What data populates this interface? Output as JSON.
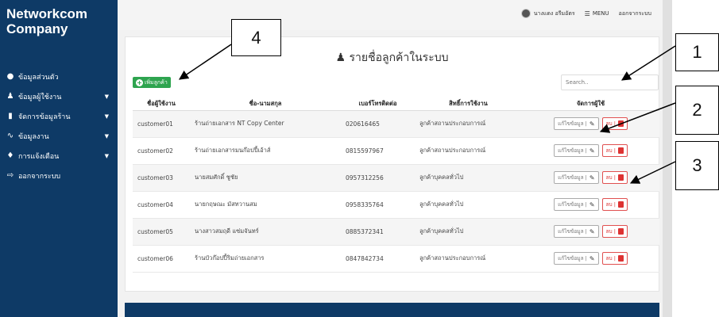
{
  "app": {
    "brand": "Networkcom Company"
  },
  "sidebar": {
    "items": [
      {
        "icon": "user-circle-icon",
        "label": "ข้อมูลส่วนตัว",
        "has_caret": false
      },
      {
        "icon": "users-icon",
        "label": "ข้อมูลผู้ใช้งาน",
        "has_caret": true
      },
      {
        "icon": "clipboard-icon",
        "label": "จัดการข้อมูลร้าน",
        "has_caret": true
      },
      {
        "icon": "chart-line-icon",
        "label": "ข้อมูลงาน",
        "has_caret": true
      },
      {
        "icon": "bell-icon",
        "label": "การแจ้งเตือน",
        "has_caret": true
      },
      {
        "icon": "sign-out-icon",
        "label": "ออกจากระบบ",
        "has_caret": false
      }
    ]
  },
  "topbar": {
    "user_name": "นางแดง อรีมอัตร",
    "menu_label": "MENU",
    "logout_label": "ออกจากระบบ"
  },
  "page": {
    "title": "รายชื่อลูกค้าในระบบ",
    "add_button_label": "เพิ่มลูกค้า",
    "search_placeholder": "Search.."
  },
  "table": {
    "columns": [
      "ชื่อผู้ใช้งาน",
      "ชื่อ-นามสกุล",
      "เบอร์โทรติดต่อ",
      "สิทธิ์การใช้งาน",
      "จัดการผู้ใช้"
    ],
    "edit_label": "แก้ไขข้อมูล |",
    "delete_label": "ลบ |",
    "rows": [
      {
        "username": "customer01",
        "name": "ร้านถ่ายเอกสาร NT Copy Center",
        "phone": "020616465",
        "role": "ลูกค้าสถานประกอบการณ์"
      },
      {
        "username": "customer02",
        "name": "ร้านถ่ายเอกสารมนก๊อปปี้เอ้าส์",
        "phone": "0815597967",
        "role": "ลูกค้าสถานประกอบการณ์"
      },
      {
        "username": "customer03",
        "name": "นายสมศักดิ์ ชูชัย",
        "phone": "0957312256",
        "role": "ลูกค้าบุคคลทั่วไป"
      },
      {
        "username": "customer04",
        "name": "นายกฤษณะ มัสทวานสม",
        "phone": "0958335764",
        "role": "ลูกค้าบุคคลทั่วไป"
      },
      {
        "username": "customer05",
        "name": "นางสาวสมฤดี แซ่มจันทร์",
        "phone": "0885372341",
        "role": "ลูกค้าบุคคลทั่วไป"
      },
      {
        "username": "customer06",
        "name": "ร้านบัวก๊อปปี้ริมถ่ายเอกสาร",
        "phone": "0847842734",
        "role": "ลูกค้าสถานประกอบการณ์"
      }
    ]
  },
  "callouts": [
    "1",
    "2",
    "3",
    "4"
  ],
  "colors": {
    "sidebar": "#0e3a66",
    "add_button": "#2ea44f",
    "delete": "#d33333"
  }
}
